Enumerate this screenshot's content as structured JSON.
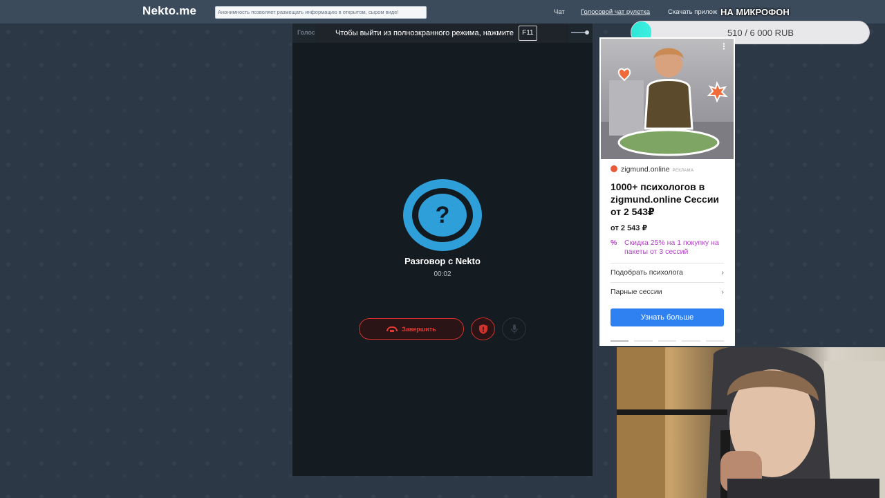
{
  "site": {
    "logo": "Nekto.me",
    "notice": "Анонимность позволяет размещать информацию в открытом, сыром виде!",
    "nav": {
      "chat": "Чат",
      "voice": "Голосовой чат рулетка",
      "app": "Скачать прилож"
    }
  },
  "overlay": {
    "mic_label": "НА МИКРОФОН",
    "donation_text": "510 / 6 000 RUB",
    "donation_progress": 0.085
  },
  "toast": {
    "text": "Чтобы выйти из полноэкранного режима, нажмите",
    "key": "F11"
  },
  "ghost_tab": "Голос",
  "call": {
    "avatar_glyph": "?",
    "title": "Разговор с Nekto",
    "timer": "00:02",
    "end_label": "Завершить"
  },
  "ad": {
    "source": "zigmund.online",
    "tag": "РЕКЛАМА",
    "headline": "1000+ психологов в zigmund.online Сессии от 2 543₽",
    "price": "от 2 543 ₽",
    "promo_icon": "%",
    "promo": "Скидка 25% на 1 покупку на пакеты от 3 сессий",
    "link1": "Подобрать психолога",
    "link2": "Парные сессии",
    "chevron": "›",
    "cta": "Узнать больше",
    "more": "⋮"
  },
  "colors": {
    "accent_blue": "#2e9fd9",
    "end_red": "#d2322d",
    "cta_blue": "#2f80f0",
    "promo_purple": "#b440c8",
    "donation_fill": "#2ee6d6"
  },
  "icons": [
    "phone-hangup-icon",
    "shield-icon",
    "microphone-icon",
    "question-icon",
    "chevron-right-icon",
    "percent-icon"
  ]
}
